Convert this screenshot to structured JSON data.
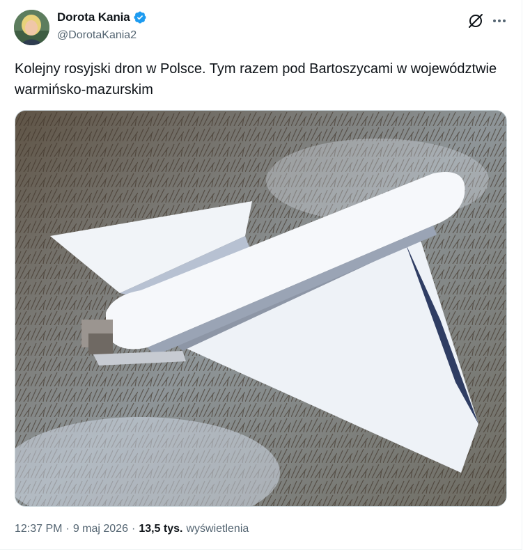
{
  "author": {
    "display_name": "Dorota Kania",
    "handle": "@DorotaKania2",
    "verified": true,
    "verified_color": "#1d9bf0"
  },
  "tweet": {
    "text": "Kolejny rosyjski dron w Polsce. Tym razem pod Bartoszycami w województwie warmińsko-mazurskim"
  },
  "media": {
    "icon": "drone-wreck-photo"
  },
  "meta": {
    "time": "12:37 PM",
    "sep1": "·",
    "date": "9 maj 2026",
    "sep2": "·",
    "views_count": "13,5 tys.",
    "views_label": "wyświetlenia"
  },
  "icons": {
    "grok": "grok-icon",
    "more": "more-options-icon"
  }
}
